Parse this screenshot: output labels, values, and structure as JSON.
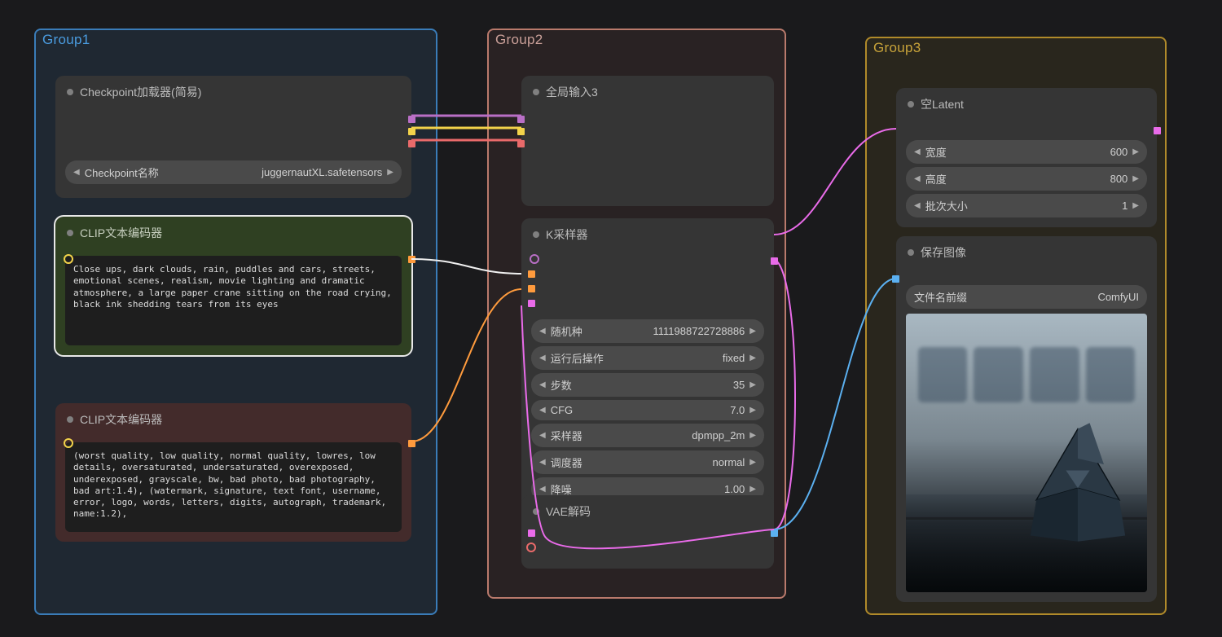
{
  "groups": {
    "g1": {
      "title": "Group1"
    },
    "g2": {
      "title": "Group2"
    },
    "g3": {
      "title": "Group3"
    }
  },
  "checkpoint": {
    "title": "Checkpoint加载器(简易)",
    "field_label": "Checkpoint名称",
    "field_value": "juggernautXL.safetensors"
  },
  "clip_pos": {
    "title": "CLIP文本编码器",
    "prompt": "Close ups, dark clouds, rain, puddles and cars, streets, emotional scenes, realism, movie lighting and dramatic atmosphere, a large paper crane sitting on the road crying, black ink shedding tears from its eyes"
  },
  "clip_neg": {
    "title": "CLIP文本编码器",
    "prompt": "(worst quality, low quality, normal quality, lowres, low details, oversaturated, undersaturated, overexposed, underexposed, grayscale, bw, bad photo, bad photography, bad art:1.4), (watermark, signature, text font, username, error, logo, words, letters, digits, autograph, trademark, name:1.2),"
  },
  "global_input": {
    "title": "全局输入3"
  },
  "ksampler": {
    "title": "K采样器",
    "seed": {
      "label": "随机种",
      "value": "1111988722728886"
    },
    "after": {
      "label": "运行后操作",
      "value": "fixed"
    },
    "steps": {
      "label": "步数",
      "value": "35"
    },
    "cfg": {
      "label": "CFG",
      "value": "7.0"
    },
    "sampler": {
      "label": "采样器",
      "value": "dpmpp_2m"
    },
    "scheduler": {
      "label": "调度器",
      "value": "normal"
    },
    "denoise": {
      "label": "降噪",
      "value": "1.00"
    }
  },
  "vae": {
    "title": "VAE解码"
  },
  "latent": {
    "title": "空Latent",
    "width": {
      "label": "宽度",
      "value": "600"
    },
    "height": {
      "label": "高度",
      "value": "800"
    },
    "batch": {
      "label": "批次大小",
      "value": "1"
    }
  },
  "save": {
    "title": "保存图像",
    "prefix": {
      "label": "文件名前缀",
      "value": "ComfyUI"
    }
  },
  "colors": {
    "model": "#b96fc6",
    "clip": "#f2d24a",
    "vae": "#e96a6a",
    "cond": "#ff9b3d",
    "latent": "#e96be9",
    "image": "#5bb0f0"
  }
}
